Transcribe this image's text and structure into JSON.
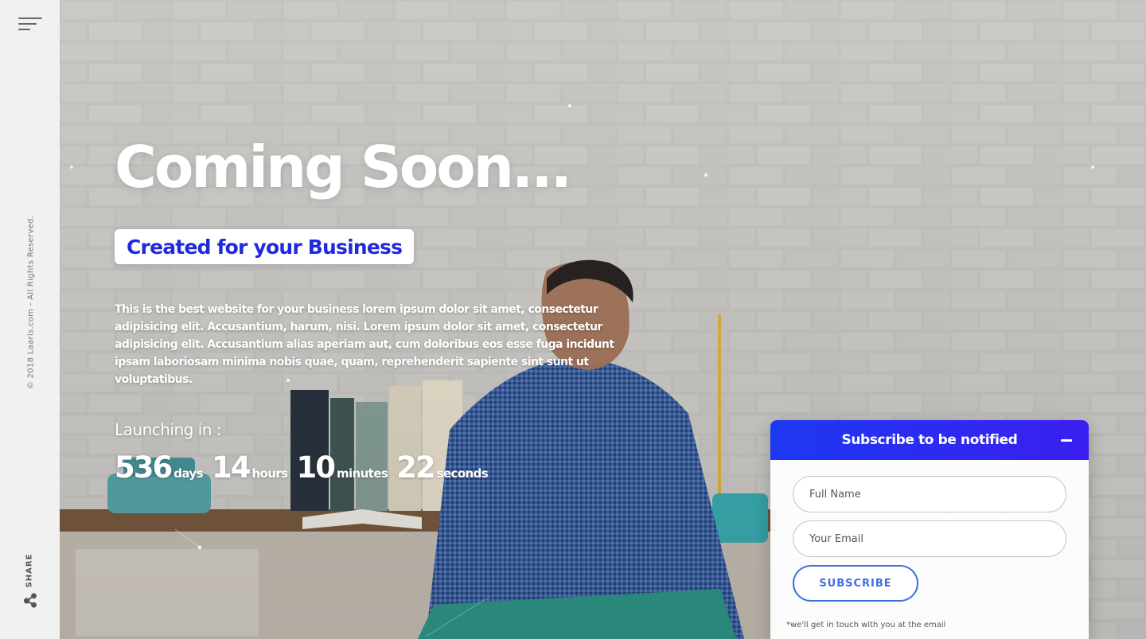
{
  "sidebar": {
    "menu_icon": "hamburger-menu-icon",
    "copyright": "© 2018 Laaris.com - All Rights Reserved.",
    "share_label": "SHARE",
    "share_icon": "share-icon"
  },
  "hero": {
    "title": "Coming Soon...",
    "tagline": "Created for your Business",
    "description": "This is the best website for your business lorem ipsum dolor sit amet, consectetur adipisicing elit. Accusantium, harum, nisi. Lorem ipsum dolor sit amet, consectetur adipisicing elit. Accusantium alias aperiam aut, cum doloribus eos esse fuga incidunt ipsam laboriosam minima nobis quae, quam, reprehenderit sapiente sint sunt ut voluptatibus.",
    "launching_label": "Launching in :",
    "countdown": {
      "days": "536",
      "days_label": "days",
      "hours": "14",
      "hours_label": "hours",
      "minutes": "10",
      "minutes_label": "minutes",
      "seconds": "22",
      "seconds_label": "seconds"
    }
  },
  "subscribe": {
    "title": "Subscribe to be notified",
    "collapse_icon": "minus-icon",
    "name_placeholder": "Full Name",
    "email_placeholder": "Your Email",
    "button_label": "SUBSCRIBE",
    "note": "*we'll get in touch with you at the email"
  },
  "colors": {
    "accent": "#2029e0",
    "header_gradient_start": "#1d38f2",
    "header_gradient_end": "#3b1ff0",
    "button_border": "#3d6fe0"
  }
}
